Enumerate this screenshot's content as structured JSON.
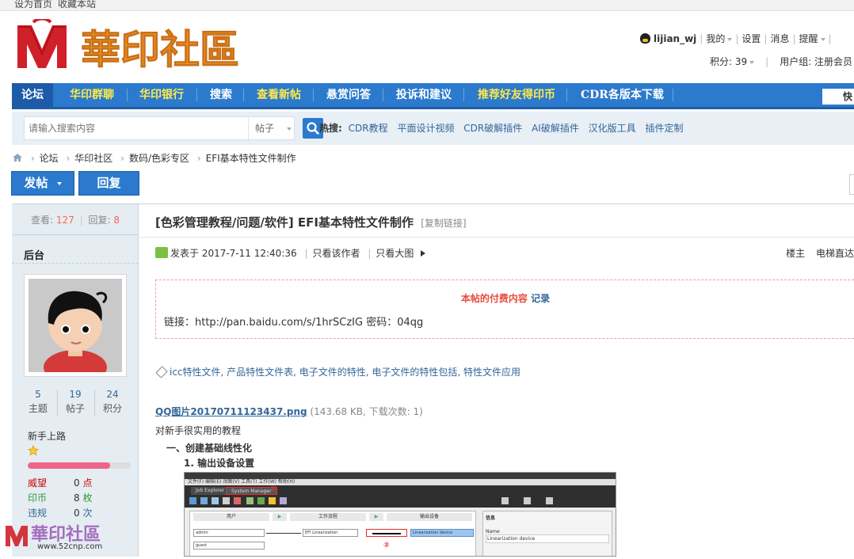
{
  "topbar": {
    "set_home": "设为首页",
    "bookmark": "收藏本站"
  },
  "logo": {
    "text": "華印社區"
  },
  "user": {
    "name": "lijian_wj",
    "my": "我的",
    "settings": "设置",
    "messages": "消息",
    "remind": "提醒",
    "points_label": "积分: 39",
    "group_label": "用户组: 注册会员"
  },
  "nav": {
    "items": [
      {
        "label": "论坛",
        "style": "active"
      },
      {
        "label": "华印群聊",
        "style": "yellow"
      },
      {
        "label": "华印银行",
        "style": "yellow"
      },
      {
        "label": "搜索",
        "style": "white"
      },
      {
        "label": "查看新帖",
        "style": "yellow"
      },
      {
        "label": "悬赏问答",
        "style": "white"
      },
      {
        "label": "投诉和建议",
        "style": "white"
      },
      {
        "label": "推荐好友得印币",
        "style": "yellow"
      },
      {
        "label": "CDR各版本下载",
        "style": "white"
      }
    ],
    "quick": "快捷"
  },
  "search": {
    "placeholder": "请输入搜索内容",
    "type": "帖子",
    "hot_label": "热搜:",
    "hot": [
      "CDR教程",
      "平面设计视频",
      "CDR破解插件",
      "AI破解插件",
      "汉化版工具",
      "插件定制"
    ]
  },
  "breadcrumb": [
    "论坛",
    "华印社区",
    "数码/色彩专区",
    "EFI基本特性文件制作"
  ],
  "actions": {
    "post": "发帖",
    "reply": "回复"
  },
  "sidebar": {
    "views_label": "查看:",
    "views": "127",
    "replies_label": "回复:",
    "replies": "8",
    "username": "后台",
    "topics": "5",
    "topics_label": "主题",
    "posts": "19",
    "posts_label": "帖子",
    "credits": "24",
    "credits_label": "积分",
    "rank": "新手上路",
    "rank_progress": 0.8,
    "rows": [
      {
        "k": "威望",
        "v": "0",
        "u": "点",
        "color": "#cc0000"
      },
      {
        "k": "印币",
        "v": "8",
        "u": "枚",
        "color": "#339933"
      },
      {
        "k": "违规",
        "v": "0",
        "u": "次",
        "color": "#336699"
      }
    ]
  },
  "post": {
    "category": "[色彩管理教程/问题/软件]",
    "title": "EFI基本特性文件制作",
    "copy_link": "[复制链接]",
    "posted": "发表于 2017-7-11 12:40:36",
    "only_author": "只看该作者",
    "only_big": "只看大图",
    "floor": "楼主",
    "elevator": "电梯直达",
    "paid_label": "本帖的付费内容",
    "paid_record": "记录",
    "link_text": "链接：http://pan.baidu.com/s/1hrSCzIG 密码：04qg",
    "tags": "icc特性文件, 产品特性文件表, 电子文件的特性, 电子文件的特性包括, 特性文件应用",
    "attachment_name": "QQ图片20170711123437.png",
    "attachment_info": "(143.68 KB, 下载次数: 1)",
    "description": "对新手很实用的教程",
    "heading1": "一、创建基础线性化",
    "heading2": "1.    输出设备设置"
  },
  "screenshot": {
    "menu": "文件(F)  编辑(E)  视图(V)  工具(T)  工作(W)  帮助(H)",
    "tab1": "Job Explorer",
    "tab2": "System Manager",
    "col1": "用户",
    "col2": "工作流程",
    "col3": "输出设备",
    "node1": "admin",
    "node2": "guest",
    "node3": "EFI Linearization",
    "node4": "Linearization device",
    "props_title": "信息",
    "props_name": "Name",
    "props_val": "Linearization device",
    "marker1": "①",
    "marker2": "②"
  },
  "watermark": {
    "text": "華印社區",
    "url": "www.52cnp.com"
  },
  "colors": {
    "nav_blue": "#2b7acd",
    "logo_red": "#d0202a",
    "logo_orange": "#f5961e"
  }
}
